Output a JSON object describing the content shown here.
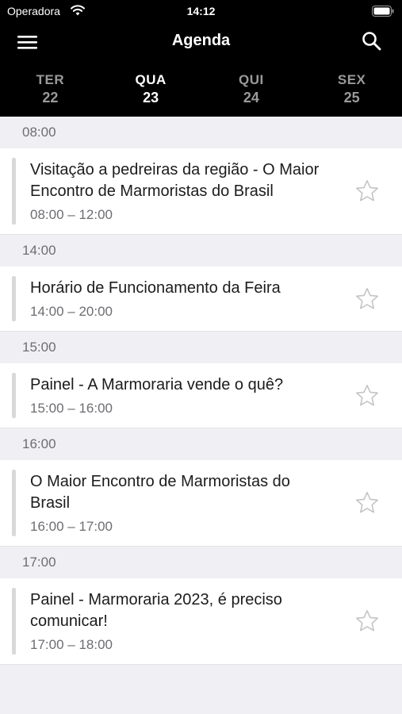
{
  "status": {
    "carrier": "Operadora",
    "time": "14:12"
  },
  "nav": {
    "title": "Agenda"
  },
  "days": [
    {
      "dow": "TER",
      "num": "22",
      "active": false
    },
    {
      "dow": "QUA",
      "num": "23",
      "active": true
    },
    {
      "dow": "QUI",
      "num": "24",
      "active": false
    },
    {
      "dow": "SEX",
      "num": "25",
      "active": false
    }
  ],
  "sections": [
    {
      "time": "08:00",
      "event": {
        "title": "Visitação a pedreiras da região - O Maior Encontro de Marmoristas do Brasil",
        "range": "08:00 – 12:00"
      }
    },
    {
      "time": "14:00",
      "event": {
        "title": "Horário de Funcionamento da Feira",
        "range": "14:00 – 20:00"
      }
    },
    {
      "time": "15:00",
      "event": {
        "title": "Painel - A Marmoraria vende o quê?",
        "range": "15:00 – 16:00"
      }
    },
    {
      "time": "16:00",
      "event": {
        "title": "O Maior Encontro de Marmoristas do Brasil",
        "range": "16:00 – 17:00"
      }
    },
    {
      "time": "17:00",
      "event": {
        "title": "Painel - Marmoraria 2023, é preciso comunicar!",
        "range": "17:00 – 18:00"
      }
    }
  ]
}
